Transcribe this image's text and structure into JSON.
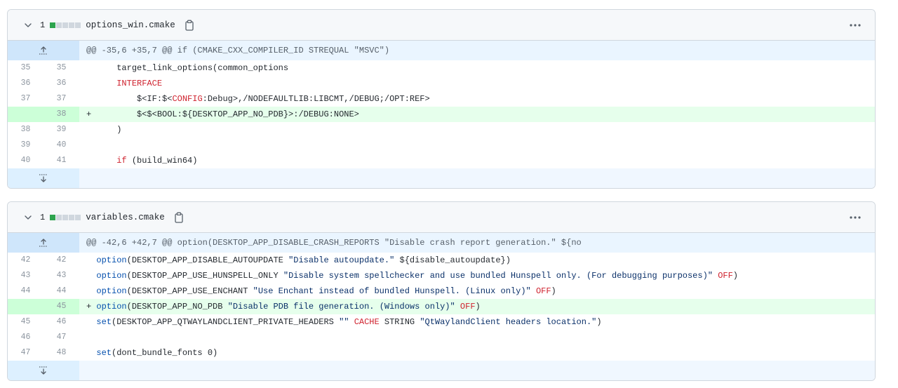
{
  "files": [
    {
      "change_count": "1",
      "name": "options_win.cmake",
      "hunk": "@@ -35,6 +35,7 @@ if (CMAKE_CXX_COMPILER_ID STREQUAL \"MSVC\")",
      "lines": [
        {
          "old": "35",
          "new": "35",
          "type": "ctx",
          "sign": " ",
          "segs": [
            {
              "t": "    target_link_options(common_options",
              "c": ""
            }
          ]
        },
        {
          "old": "36",
          "new": "36",
          "type": "ctx",
          "sign": " ",
          "segs": [
            {
              "t": "    ",
              "c": ""
            },
            {
              "t": "INTERFACE",
              "c": "kw"
            }
          ]
        },
        {
          "old": "37",
          "new": "37",
          "type": "ctx",
          "sign": " ",
          "segs": [
            {
              "t": "        $<IF:$<",
              "c": ""
            },
            {
              "t": "CONFIG",
              "c": "kw"
            },
            {
              "t": ":Debug>,/NODEFAULTLIB:LIBCMT,/DEBUG;/OPT:REF>",
              "c": ""
            }
          ]
        },
        {
          "old": "",
          "new": "38",
          "type": "add",
          "sign": "+",
          "segs": [
            {
              "t": "        $<$<BOOL:${DESKTOP_APP_NO_PDB}>:/DEBUG:NONE>",
              "c": ""
            }
          ]
        },
        {
          "old": "38",
          "new": "39",
          "type": "ctx",
          "sign": " ",
          "segs": [
            {
              "t": "    )",
              "c": ""
            }
          ]
        },
        {
          "old": "39",
          "new": "40",
          "type": "ctx",
          "sign": " ",
          "segs": [
            {
              "t": "",
              "c": ""
            }
          ]
        },
        {
          "old": "40",
          "new": "41",
          "type": "ctx",
          "sign": " ",
          "segs": [
            {
              "t": "    ",
              "c": ""
            },
            {
              "t": "if",
              "c": "kw"
            },
            {
              "t": " (build_win64)",
              "c": ""
            }
          ]
        }
      ]
    },
    {
      "change_count": "1",
      "name": "variables.cmake",
      "hunk": "@@ -42,6 +42,7 @@ option(DESKTOP_APP_DISABLE_CRASH_REPORTS \"Disable crash report generation.\" ${no",
      "lines": [
        {
          "old": "42",
          "new": "42",
          "type": "ctx",
          "sign": " ",
          "segs": [
            {
              "t": "option",
              "c": "fn"
            },
            {
              "t": "(DESKTOP_APP_DISABLE_AUTOUPDATE ",
              "c": ""
            },
            {
              "t": "\"Disable autoupdate.\"",
              "c": "str"
            },
            {
              "t": " ${disable_autoupdate})",
              "c": ""
            }
          ]
        },
        {
          "old": "43",
          "new": "43",
          "type": "ctx",
          "sign": " ",
          "segs": [
            {
              "t": "option",
              "c": "fn"
            },
            {
              "t": "(DESKTOP_APP_USE_HUNSPELL_ONLY ",
              "c": ""
            },
            {
              "t": "\"Disable system spellchecker and use bundled Hunspell only. (For debugging purposes)\"",
              "c": "str"
            },
            {
              "t": " ",
              "c": ""
            },
            {
              "t": "OFF",
              "c": "kw"
            },
            {
              "t": ")",
              "c": ""
            }
          ]
        },
        {
          "old": "44",
          "new": "44",
          "type": "ctx",
          "sign": " ",
          "segs": [
            {
              "t": "option",
              "c": "fn"
            },
            {
              "t": "(DESKTOP_APP_USE_ENCHANT ",
              "c": ""
            },
            {
              "t": "\"Use Enchant instead of bundled Hunspell. (Linux only)\"",
              "c": "str"
            },
            {
              "t": " ",
              "c": ""
            },
            {
              "t": "OFF",
              "c": "kw"
            },
            {
              "t": ")",
              "c": ""
            }
          ]
        },
        {
          "old": "",
          "new": "45",
          "type": "add",
          "sign": "+",
          "segs": [
            {
              "t": "option",
              "c": "fn"
            },
            {
              "t": "(DESKTOP_APP_NO_PDB ",
              "c": ""
            },
            {
              "t": "\"Disable PDB file generation. (Windows only)\"",
              "c": "str"
            },
            {
              "t": " ",
              "c": ""
            },
            {
              "t": "OFF",
              "c": "kw"
            },
            {
              "t": ")",
              "c": ""
            }
          ]
        },
        {
          "old": "45",
          "new": "46",
          "type": "ctx",
          "sign": " ",
          "segs": [
            {
              "t": "set",
              "c": "fn"
            },
            {
              "t": "(DESKTOP_APP_QTWAYLANDCLIENT_PRIVATE_HEADERS ",
              "c": ""
            },
            {
              "t": "\"\"",
              "c": "str"
            },
            {
              "t": " ",
              "c": ""
            },
            {
              "t": "CACHE",
              "c": "kw"
            },
            {
              "t": " STRING ",
              "c": ""
            },
            {
              "t": "\"QtWaylandClient headers location.\"",
              "c": "str"
            },
            {
              "t": ")",
              "c": ""
            }
          ]
        },
        {
          "old": "46",
          "new": "47",
          "type": "ctx",
          "sign": " ",
          "segs": [
            {
              "t": "",
              "c": ""
            }
          ]
        },
        {
          "old": "47",
          "new": "48",
          "type": "ctx",
          "sign": " ",
          "segs": [
            {
              "t": "set",
              "c": "fn"
            },
            {
              "t": "(dont_bundle_fonts 0)",
              "c": ""
            }
          ]
        }
      ]
    }
  ],
  "colors": {
    "added_bg": "#e6ffec",
    "added_num_bg": "#ccffd8",
    "hunk_bg": "#ddf4ff",
    "keyword": "#cf222e",
    "function": "#0550ae",
    "string": "#0a3069"
  },
  "icons": {
    "collapse": "chevron-down-icon",
    "copy": "clipboard-icon",
    "more": "kebab-horizontal-icon",
    "expand_up": "expand-up-icon",
    "expand_down": "expand-down-icon"
  }
}
